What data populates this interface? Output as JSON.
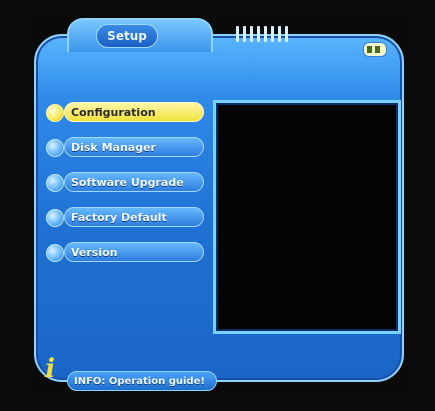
{
  "header": {
    "title": "Setup"
  },
  "menu": {
    "items": [
      {
        "label": "Configuration",
        "selected": true
      },
      {
        "label": "Disk Manager",
        "selected": false
      },
      {
        "label": "Software Upgrade",
        "selected": false
      },
      {
        "label": "Factory Default",
        "selected": false
      },
      {
        "label": "Version",
        "selected": false
      }
    ]
  },
  "info": {
    "icon": "info-icon",
    "text": "INFO: Operation guide!"
  },
  "status": {
    "battery_icon": "battery-icon"
  },
  "colors": {
    "panel_blue": "#1f71d3",
    "selected_yellow": "#f0e23c",
    "preview_bg": "#050505"
  }
}
